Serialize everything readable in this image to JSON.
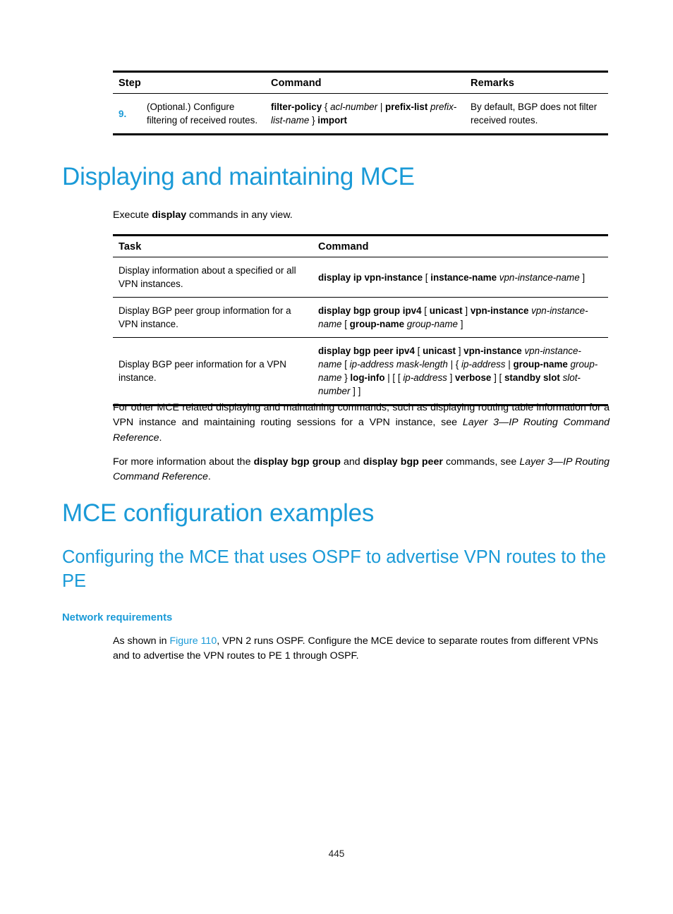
{
  "page": {
    "number": "445"
  },
  "step_table": {
    "headers": {
      "step": "Step",
      "command": "Command",
      "remarks": "Remarks"
    },
    "rows": [
      {
        "num": "9.",
        "step": "(Optional.) Configure filtering of received routes.",
        "command_parts": [
          {
            "text": "filter-policy",
            "style": "b"
          },
          {
            "text": " { ",
            "style": "n"
          },
          {
            "text": "acl-number",
            "style": "i"
          },
          {
            "text": " | ",
            "style": "n"
          },
          {
            "text": "prefix-list",
            "style": "b"
          },
          {
            "text": " ",
            "style": "n"
          },
          {
            "text": "prefix-list-name",
            "style": "i"
          },
          {
            "text": " } ",
            "style": "n"
          },
          {
            "text": "import",
            "style": "b"
          }
        ],
        "remarks": "By default, BGP does not filter received routes."
      }
    ]
  },
  "displaying_section": {
    "heading": "Displaying and maintaining MCE",
    "intro_parts": [
      {
        "text": "Execute ",
        "style": "n"
      },
      {
        "text": "display",
        "style": "b"
      },
      {
        "text": " commands in any view.",
        "style": "n"
      }
    ]
  },
  "display_table": {
    "headers": {
      "task": "Task",
      "command": "Command"
    },
    "rows": [
      {
        "task": "Display information about a specified or all VPN instances.",
        "command_parts": [
          {
            "text": "display ip vpn-instance",
            "style": "b"
          },
          {
            "text": " [ ",
            "style": "n"
          },
          {
            "text": "instance-name",
            "style": "b"
          },
          {
            "text": " ",
            "style": "n"
          },
          {
            "text": "vpn-instance-name",
            "style": "i"
          },
          {
            "text": " ]",
            "style": "n"
          }
        ]
      },
      {
        "task": "Display BGP peer group information for a VPN instance.",
        "command_parts": [
          {
            "text": "display bgp group ipv4",
            "style": "b"
          },
          {
            "text": " [ ",
            "style": "n"
          },
          {
            "text": "unicast",
            "style": "b"
          },
          {
            "text": " ] ",
            "style": "n"
          },
          {
            "text": "vpn-instance",
            "style": "b"
          },
          {
            "text": " ",
            "style": "n"
          },
          {
            "text": "vpn-instance-name",
            "style": "i"
          },
          {
            "text": " [ ",
            "style": "n"
          },
          {
            "text": "group-name",
            "style": "b"
          },
          {
            "text": " ",
            "style": "n"
          },
          {
            "text": "group-name",
            "style": "i"
          },
          {
            "text": " ]",
            "style": "n"
          }
        ]
      },
      {
        "task": "Display BGP peer information for a VPN instance.",
        "command_parts": [
          {
            "text": "display bgp peer ipv4",
            "style": "b"
          },
          {
            "text": " [ ",
            "style": "n"
          },
          {
            "text": "unicast",
            "style": "b"
          },
          {
            "text": " ] ",
            "style": "n"
          },
          {
            "text": "vpn-instance",
            "style": "b"
          },
          {
            "text": " ",
            "style": "n"
          },
          {
            "text": "vpn-instance-name",
            "style": "i"
          },
          {
            "text": " [ ",
            "style": "n"
          },
          {
            "text": "ip-address mask-length",
            "style": "i"
          },
          {
            "text": " | { ",
            "style": "n"
          },
          {
            "text": "ip-address",
            "style": "i"
          },
          {
            "text": " | ",
            "style": "n"
          },
          {
            "text": "group-name",
            "style": "b"
          },
          {
            "text": " ",
            "style": "n"
          },
          {
            "text": "group-name",
            "style": "i"
          },
          {
            "text": " } ",
            "style": "n"
          },
          {
            "text": "log-info",
            "style": "b"
          },
          {
            "text": " | [ [ ",
            "style": "n"
          },
          {
            "text": "ip-address",
            "style": "i"
          },
          {
            "text": " ] ",
            "style": "n"
          },
          {
            "text": "verbose",
            "style": "b"
          },
          {
            "text": " ] [ ",
            "style": "n"
          },
          {
            "text": "standby slot",
            "style": "b"
          },
          {
            "text": " ",
            "style": "n"
          },
          {
            "text": "slot-number",
            "style": "i"
          },
          {
            "text": " ] ]",
            "style": "n"
          }
        ]
      }
    ]
  },
  "paragraphs": {
    "p1_parts": [
      {
        "text": "For other MCE related displaying and maintaining commands, such as displaying routing table information for a VPN instance and maintaining routing sessions for a VPN instance, see ",
        "style": "n"
      },
      {
        "text": "Layer 3—IP Routing Command Reference",
        "style": "i"
      },
      {
        "text": ".",
        "style": "n"
      }
    ],
    "p2_parts": [
      {
        "text": "For more information about the ",
        "style": "n"
      },
      {
        "text": "display bgp group",
        "style": "b"
      },
      {
        "text": " and ",
        "style": "n"
      },
      {
        "text": "display bgp peer",
        "style": "b"
      },
      {
        "text": " commands, see ",
        "style": "n"
      },
      {
        "text": "Layer 3—IP Routing Command Reference",
        "style": "i"
      },
      {
        "text": ".",
        "style": "n"
      }
    ]
  },
  "examples_section": {
    "heading": "MCE configuration examples",
    "subheading": "Configuring the MCE that uses OSPF to advertise VPN routes to the PE",
    "requirements_heading": "Network requirements",
    "requirements_parts": [
      {
        "text": "As shown in ",
        "style": "n"
      },
      {
        "text": "Figure 110",
        "style": "link"
      },
      {
        "text": ", VPN 2 runs OSPF. Configure the MCE device to separate routes from different VPNs and to advertise the VPN routes to PE 1 through OSPF.",
        "style": "n"
      }
    ]
  }
}
